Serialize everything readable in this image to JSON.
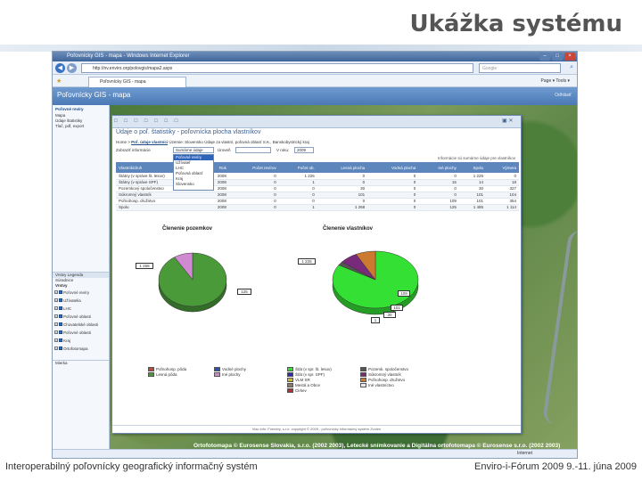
{
  "slide": {
    "title": "Ukážka systému",
    "footer_left": "Interoperabilný poľovnícky geografický informačný systém",
    "footer_right": "Enviro-i-Fórum 2009 9.-11. júna 2009"
  },
  "browser": {
    "window_title": "Poľovnícky GIS - mapa - Windows Internet Explorer",
    "url": "http://nv.enviro.org/polovgis/mapa2.aspx",
    "search_placeholder": "Google",
    "tab_label": "Poľovnícky GIS - mapa",
    "tools": "Page ▾  Tools ▾",
    "status": "Internet"
  },
  "app": {
    "title": "Poľovnícky GIS - mapa",
    "header_right": "Odhlásiť"
  },
  "left_panel": {
    "heading": "Poľovné revíry",
    "lines": [
      "Mapa",
      "Údaje štatistiky",
      "Tlač, pdf, export"
    ],
    "layers_tabs": "Vrstvy   Legenda",
    "section": "Súradnice",
    "sub": "Vrstvy",
    "layers": [
      "Poľovné revíry",
      "Užívatelia",
      "LHC",
      "Poľovné oblasti",
      "Chovatelské oblasti",
      "Poľovné oblasti",
      "Kraj",
      "Ortofotomapa"
    ],
    "bottom": "Mierka"
  },
  "dialog": {
    "toolbar": "□ □ □ □ □ □ □",
    "heading": "Údaje o poľ. štatistiky - poľovnícka plocha vlastníkov",
    "crumb_prefix": "Home",
    "crumb_link": "Poľ. údaje vlastníci",
    "crumb_rest": "Územie: Slovensko   Údaje za vlastní, poľovná oblasť   S.K., Banskobystrický kraj",
    "filter_label": "Zobraziť informácie",
    "filter_value": "Sumárne údaje",
    "level_label": "Úroveň",
    "year_label": "V roku:",
    "year_value": "2009",
    "dropdown_options": [
      "Poľovné revíry",
      "Užívateľ",
      "LHC",
      "Poľovná oblasť",
      "Kraj",
      "Slovensko"
    ],
    "table_note": "Informácie sú sumárne údaje pre vlastníkov",
    "table_headers": [
      "Vlastník/druh",
      "Rok",
      "Počet revírov",
      "Počet ob.",
      "Lesná plocha",
      "Vodná plocha",
      "Iné plochy",
      "Spolu",
      "Výmera"
    ],
    "table_rows": [
      [
        "Štátny (v správe št. lesov)",
        "2008",
        "0",
        "1 225",
        "0",
        "0",
        "0",
        "1 225",
        "0"
      ],
      [
        "Štátny (v správe SPF)",
        "2008",
        "0",
        "1",
        "0",
        "0",
        "15",
        "14",
        "18"
      ],
      [
        "Pozemkový spoločenstvo",
        "2008",
        "0",
        "0",
        "30",
        "0",
        "0",
        "30",
        "327"
      ],
      [
        "Súkromný vlastník",
        "2008",
        "0",
        "0",
        "101",
        "0",
        "0",
        "101",
        "104"
      ],
      [
        "Poľnohosp. družstvo",
        "2008",
        "0",
        "0",
        "0",
        "0",
        "109",
        "101",
        "354"
      ],
      [
        "Spolu",
        "2008",
        "0",
        "1",
        "1 268",
        "0",
        "125",
        "1 485",
        "1 114"
      ]
    ],
    "footer": "Viac info: Forestry, s.r.o. copyright © 2009 - poľovnícky informačný systém Zvolen"
  },
  "chart_data": [
    {
      "type": "pie",
      "title": "Členenie pozemkov",
      "series": [
        {
          "name": "Poľnohosp. pôda",
          "value": 0
        },
        {
          "name": "Lesná pôda",
          "value": 1268
        },
        {
          "name": "Vodné plochy",
          "value": 0
        },
        {
          "name": "Iné plochy",
          "value": 125
        }
      ],
      "data_labels": [
        "1 268",
        "125"
      ],
      "colors": [
        "#b84a3c",
        "#4a9a3a",
        "#2b4fb5",
        "#d08ad0"
      ]
    },
    {
      "type": "pie",
      "title": "Členenie vlastníkov",
      "series": [
        {
          "name": "Štát (v spr. št. lesov)",
          "value": 1225
        },
        {
          "name": "Štát (v spr. SPF)",
          "value": 0
        },
        {
          "name": "VLM SR",
          "value": 0
        },
        {
          "name": "Mestá a Obce",
          "value": 0
        },
        {
          "name": "Cirkev",
          "value": 0
        },
        {
          "name": "Pozemk. spoločenstvo",
          "value": 30
        },
        {
          "name": "Súkromný vlastník",
          "value": 101
        },
        {
          "name": "Poľnohosp. družstvo",
          "value": 109
        },
        {
          "name": "Iné vlastníctvo",
          "value": 0
        }
      ],
      "data_labels": [
        "1 225",
        "109",
        "101",
        "30",
        "1"
      ],
      "colors": [
        "#35e035",
        "#2b2bb8",
        "#ccb82a",
        "#8a7a6a",
        "#b03030",
        "#555555",
        "#7a2a7a",
        "#cc7a30",
        "#e8e8f0"
      ]
    }
  ]
}
